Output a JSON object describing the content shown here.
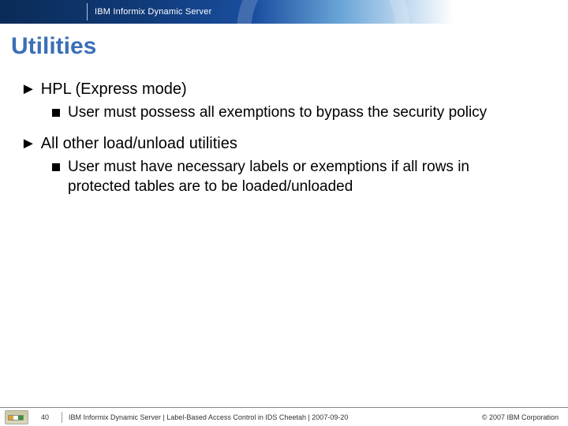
{
  "header": {
    "product": "IBM Informix Dynamic Server",
    "logo_name": "ibm-logo"
  },
  "title": "Utilities",
  "bullets": [
    {
      "text": "HPL (Express mode)",
      "children": [
        "User must possess all exemptions to bypass the security policy"
      ]
    },
    {
      "text": "All other load/unload utilities",
      "children": [
        "User must have necessary labels or exemptions if all rows in protected tables are to be loaded/unloaded"
      ]
    }
  ],
  "footer": {
    "page": "40",
    "text": "IBM Informix Dynamic Server  |  Label-Based Access Control in IDS Cheetah | 2007-09-20",
    "copyright": "© 2007 IBM Corporation"
  }
}
